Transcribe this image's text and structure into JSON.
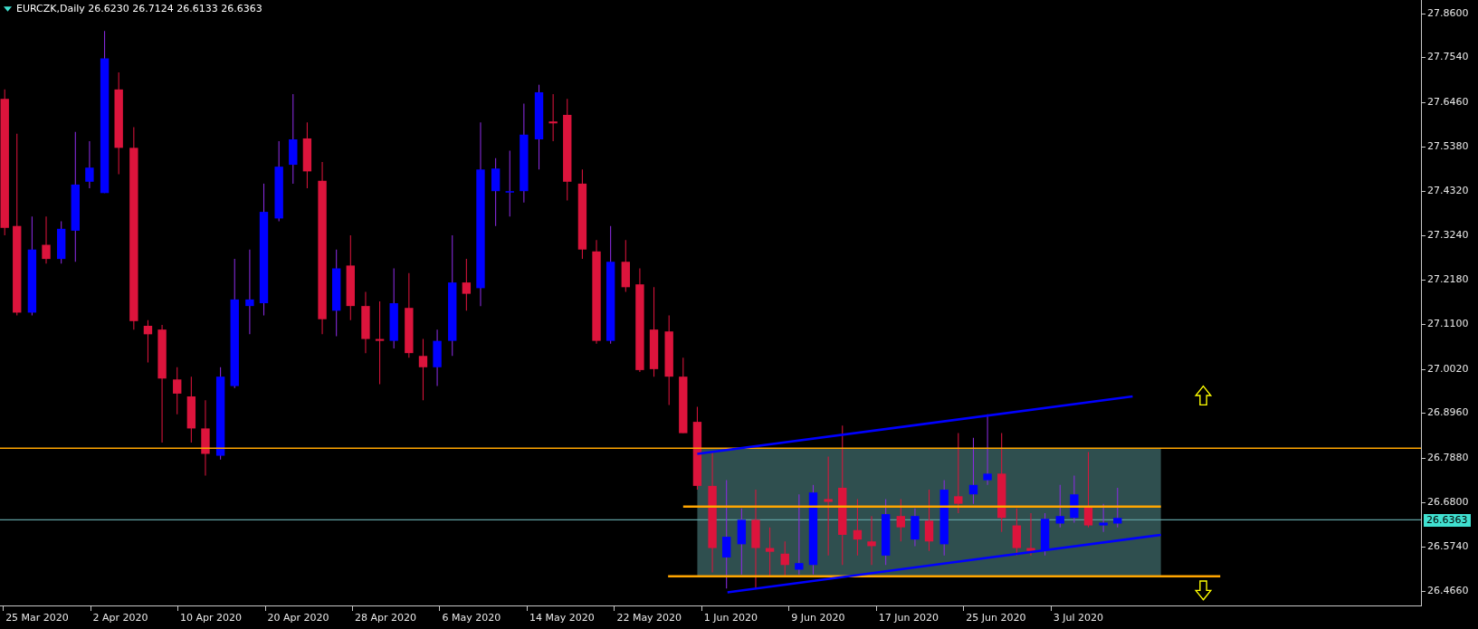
{
  "chart_header": {
    "title": "EURCZK,Daily 26.6230 26.7124 26.6133 26.6363"
  },
  "price_axis": {
    "labels": [
      "27.8600",
      "27.7540",
      "27.6460",
      "27.5380",
      "27.4320",
      "27.3240",
      "27.2180",
      "27.1100",
      "27.0020",
      "26.8960",
      "26.7880",
      "26.6800",
      "26.5740",
      "26.4660"
    ],
    "current_price": "26.6363"
  },
  "time_axis": {
    "labels": [
      "25 Mar 2020",
      "2 Apr 2020",
      "10 Apr 2020",
      "20 Apr 2020",
      "28 Apr 2020",
      "6 May 2020",
      "14 May 2020",
      "22 May 2020",
      "1 Jun 2020",
      "9 Jun 2020",
      "17 Jun 2020",
      "25 Jun 2020",
      "3 Jul 2020"
    ]
  }
}
